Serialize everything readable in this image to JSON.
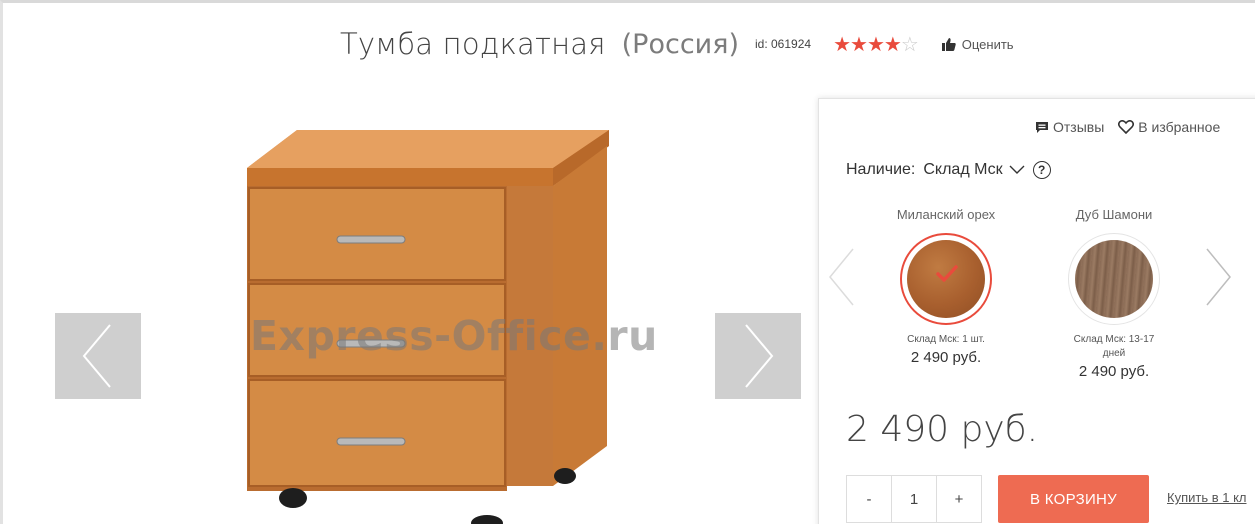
{
  "product": {
    "title": "Тумба подкатная",
    "country": "(Россия)",
    "id_text": "id: 061924",
    "rating": {
      "value": 4,
      "max": 5
    },
    "rate_label": "Оценить"
  },
  "gallery": {
    "watermark": "Express-Office.ru",
    "prev_icon": "chevron-left-icon",
    "next_icon": "chevron-right-icon"
  },
  "panel": {
    "reviews_label": "Отзывы",
    "favorites_label": "В избранное",
    "availability_label": "Наличие:",
    "store_value": "Склад Мск",
    "help_glyph": "?",
    "swatches": [
      {
        "name": "Миланский орех",
        "stock": "Склад Мск: 1 шт.",
        "price": "2 490 руб.",
        "selected": true,
        "color": "#a85f2e"
      },
      {
        "name": "Дуб Шамони",
        "stock": "Склад Мск: 13-17 дней",
        "price": "2 490 руб.",
        "selected": false,
        "color": "#8a6b55"
      }
    ],
    "price": "2 490 руб.",
    "qty": {
      "minus": "-",
      "value": "1",
      "plus": "+"
    },
    "cart_button": "В КОРЗИНУ",
    "buy_one_click": "Купить в 1 кл"
  },
  "colors": {
    "accent": "#e94b3c",
    "cart_button": "#ee6b52",
    "arrow_bg": "#cfcfcf"
  }
}
